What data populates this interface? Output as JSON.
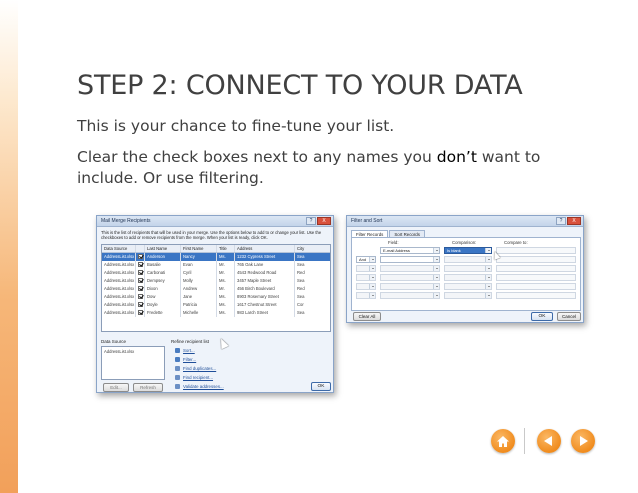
{
  "slide": {
    "title": "STEP 2: CONNECT TO YOUR DATA",
    "paragraph1": "This is your chance to fine-tune your list.",
    "paragraph2_before": "Clear the check boxes next to any names you ",
    "paragraph2_emphasis": "don’t",
    "paragraph2_after": " want to include. Or use filtering."
  },
  "mail_merge_dialog": {
    "title": "Mail Merge Recipients",
    "help_glyph": "?",
    "close_glyph": "X",
    "description": "This is the list of recipients that will be used in your merge. Use the options below to add to or change your list. Use the checkboxes to add or remove recipients from the merge. When your list is ready, click OK.",
    "columns": [
      "Data Source",
      "",
      "Last Name",
      "First Name",
      "Title",
      "Address",
      "City"
    ],
    "rows": [
      {
        "source": "AddressList.xlsx",
        "last": "Anderson",
        "first": "Nancy",
        "title": "Ms.",
        "address": "1232 Cypress Street",
        "city": "Sea",
        "selected": true
      },
      {
        "source": "AddressList.xlsx",
        "last": "Basalie",
        "first": "Evan",
        "title": "Mr.",
        "address": "765 Oak Lane",
        "city": "Sea",
        "selected": false
      },
      {
        "source": "AddressList.xlsx",
        "last": "Carbonati",
        "first": "Cyril",
        "title": "Mr.",
        "address": "4543 Redwood Road",
        "city": "Red",
        "selected": false
      },
      {
        "source": "AddressList.xlsx",
        "last": "Dempsey",
        "first": "Molly",
        "title": "Ms.",
        "address": "3457 Maple Street",
        "city": "Sea",
        "selected": false
      },
      {
        "source": "AddressList.xlsx",
        "last": "Dixon",
        "first": "Andrew",
        "title": "Mr.",
        "address": "456 Birch Boulevard",
        "city": "Red",
        "selected": false
      },
      {
        "source": "AddressList.xlsx",
        "last": "Dow",
        "first": "Jane",
        "title": "Ms.",
        "address": "8903 Rosemary Street",
        "city": "Sea",
        "selected": false
      },
      {
        "source": "AddressList.xlsx",
        "last": "Doyle",
        "first": "Patricia",
        "title": "Ms.",
        "address": "1617 Chestnut Street",
        "city": "Cor",
        "selected": false
      },
      {
        "source": "AddressList.xlsx",
        "last": "Fredette",
        "first": "Michelle",
        "title": "Ms.",
        "address": "983 Larch Street",
        "city": "Sea",
        "selected": false
      }
    ],
    "data_source_label": "Data Source",
    "data_source_item": "AddressList.xlsx",
    "refine_label": "Refine recipient list",
    "refine_links": [
      "Sort...",
      "Filter...",
      "Find duplicates...",
      "Find recipient...",
      "Validate addresses..."
    ],
    "edit_button": "Edit...",
    "refresh_button": "Refresh",
    "ok_button": "OK"
  },
  "filter_sort_dialog": {
    "title": "Filter and Sort",
    "help_glyph": "?",
    "close_glyph": "X",
    "tabs": [
      "Filter Records",
      "Sort Records"
    ],
    "headers": {
      "field": "Field:",
      "comparison": "Comparison:",
      "compare_to": "Compare to:"
    },
    "row1": {
      "field": "E-mail Address",
      "comparison": "Is blank"
    },
    "row2_operator": "And",
    "clear_all_button": "Clear All",
    "ok_button": "OK",
    "cancel_button": "Cancel"
  }
}
